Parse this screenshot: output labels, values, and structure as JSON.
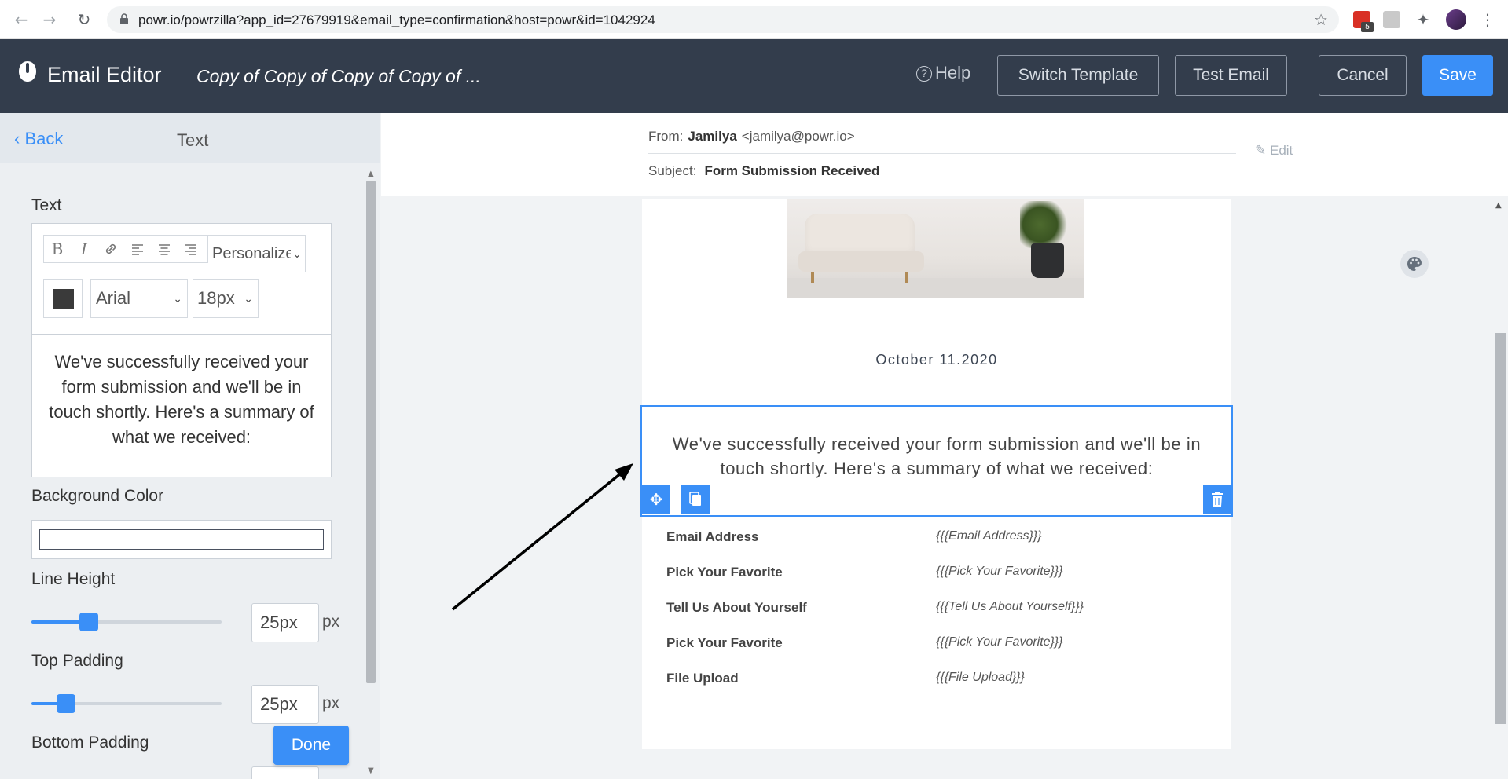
{
  "browser": {
    "back": "←",
    "forward": "→",
    "reload": "↻",
    "url": "powr.io/powrzilla?app_id=27679919&email_type=confirmation&host=powr&id=1042924",
    "star": "☆",
    "ext_badge": "5",
    "puzzle": "✦",
    "menu": "⋮"
  },
  "header": {
    "app_title": "Email Editor",
    "doc_title": "Copy of Copy of Copy of Copy of ...",
    "help": "Help",
    "help_icon": "?",
    "switch_template": "Switch Template",
    "test_email": "Test Email",
    "cancel": "Cancel",
    "save": "Save",
    "accent": "#3a8ff7",
    "bg": "#333d4c"
  },
  "panel": {
    "back": "‹ Back",
    "title": "Text",
    "text_label": "Text",
    "toolbar": {
      "bold": "B",
      "italic": "I",
      "link": "🔗",
      "align_left": "≡",
      "align_center": "≡",
      "align_right": "≡",
      "personalize": "Personalize",
      "font": "Arial",
      "size": "18px",
      "text_color": "#3a3a3a"
    },
    "editor_text": "We've successfully received your form submission and we'll be in touch shortly. Here's a summary of what we received:",
    "bg_color_label": "Background Color",
    "line_height_label": "Line Height",
    "line_height_value": "25px",
    "line_height_fraction": 0.3,
    "top_padding_label": "Top Padding",
    "top_padding_value": "25px",
    "top_padding_fraction": 0.18,
    "bottom_padding_label": "Bottom Padding",
    "unit": "px",
    "done": "Done"
  },
  "email": {
    "from_label": "From:",
    "from_name": "Jamilya",
    "from_address": "<jamilya@powr.io>",
    "subject_label": "Subject:",
    "subject": "Form Submission Received",
    "edit": "Edit",
    "date": "October 11.2020",
    "message": "We've successfully received your form submission and we'll be in touch shortly. Here's a summary of what we received:",
    "rows": [
      {
        "label": "Email Address",
        "value": "{{{Email Address}}}"
      },
      {
        "label": "Pick Your Favorite",
        "value": "{{{Pick Your Favorite}}}"
      },
      {
        "label": "Tell Us About Yourself",
        "value": "{{{Tell Us About Yourself}}}"
      },
      {
        "label": "Pick Your Favorite",
        "value": "{{{Pick Your Favorite}}}"
      },
      {
        "label": "File Upload",
        "value": "{{{File Upload}}}"
      }
    ]
  },
  "icons": {
    "move": "✥",
    "copy": "❐",
    "delete": "🗑",
    "palette": "🎨",
    "edit": "✎",
    "chevron": "⌄"
  }
}
